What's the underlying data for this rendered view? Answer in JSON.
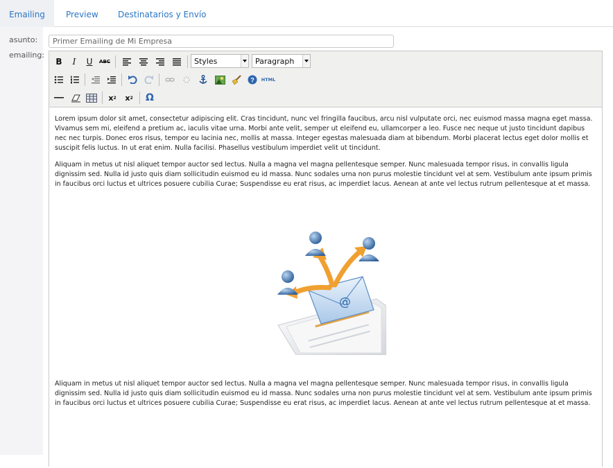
{
  "tabs": [
    "Emailing",
    "Preview",
    "Destinatarios y Envío"
  ],
  "form": {
    "asunto_label": "asunto:",
    "emailing_label": "emailing:",
    "subject_value": "Primer Emailing de Mi Empresa"
  },
  "toolbar": {
    "styles_label": "Styles",
    "paragraph_label": "Paragraph",
    "html_label": "HTML",
    "strike_label": "ABC",
    "omega": "Ω"
  },
  "content": {
    "p1": " Lorem ipsum dolor sit amet, consectetur adipiscing elit. Cras tincidunt, nunc vel fringilla faucibus, arcu nisl vulputate orci, nec euismod massa magna eget massa. Vivamus sem mi, eleifend a pretium ac, iaculis vitae urna. Morbi ante velit, semper ut eleifend eu, ullamcorper a leo. Fusce nec neque ut justo tincidunt dapibus nec nec turpis. Donec eros risus, tempor eu lacinia nec, mollis at massa. Integer egestas malesuada diam at bibendum. Morbi placerat lectus eget dolor mollis et suscipit felis luctus. In ut erat enim. Nulla facilisi. Phasellus vestibulum imperdiet velit ut tincidunt.",
    "p2": "Aliquam in metus ut nisl aliquet tempor auctor sed lectus. Nulla a magna vel magna pellentesque semper. Nunc malesuada tempor risus, in convallis ligula dignissim sed. Nulla id justo quis diam sollicitudin euismod eu id massa. Nunc sodales urna non purus molestie tincidunt vel at sem. Vestibulum ante ipsum primis in faucibus orci luctus et ultrices posuere cubilia Curae; Suspendisse eu erat risus, ac imperdiet lacus. Aenean at ante vel lectus rutrum pellentesque at et massa.",
    "p3": "Aliquam in metus ut nisl aliquet tempor auctor sed lectus. Nulla a magna vel magna pellentesque semper. Nunc malesuada tempor risus, in convallis ligula dignissim sed. Nulla id justo quis diam sollicitudin euismod eu id massa. Nunc sodales urna non purus molestie tincidunt vel at sem. Vestibulum ante ipsum primis in faucibus orci luctus et ultrices posuere cubilia Curae; Suspendisse eu erat risus, ac imperdiet lacus. Aenean at ante vel lectus rutrum pellentesque at et massa.",
    "image_email_symbol": "@"
  },
  "colors": {
    "accent": "#2b76c4",
    "arrow": "#f0a030",
    "person": "#4a7fb5"
  }
}
